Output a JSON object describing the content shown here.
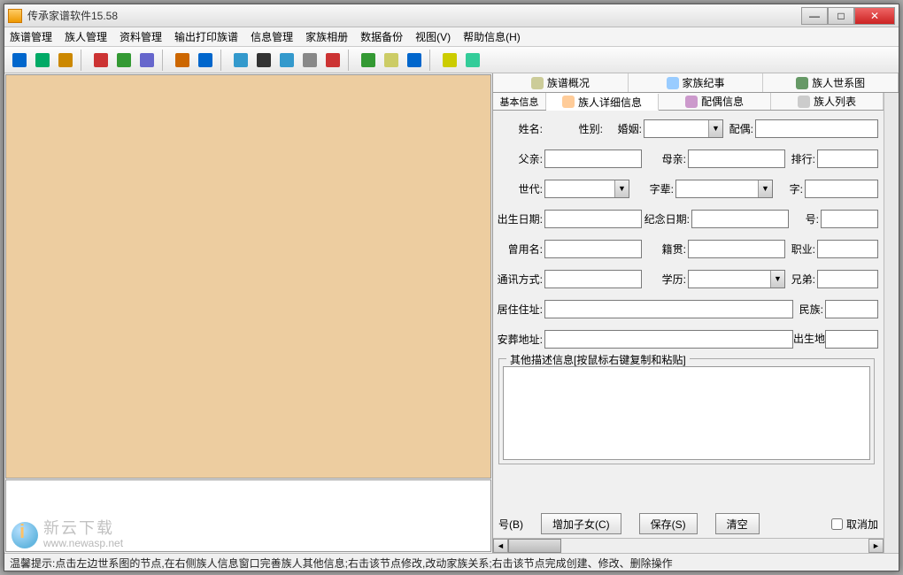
{
  "window": {
    "title": "传承家谱软件15.58"
  },
  "menu": [
    "族谱管理",
    "族人管理",
    "资料管理",
    "输出打印族谱",
    "信息管理",
    "家族相册",
    "数据备份",
    "视图(V)",
    "帮助信息(H)"
  ],
  "toolbar_icons": [
    {
      "name": "book-icon",
      "c": "#06c"
    },
    {
      "name": "globe-icon",
      "c": "#0a6"
    },
    {
      "name": "export-icon",
      "c": "#c80"
    },
    {
      "sep": true
    },
    {
      "name": "user-add-icon",
      "c": "#c33"
    },
    {
      "name": "user-del-icon",
      "c": "#393"
    },
    {
      "name": "user-edit-icon",
      "c": "#66c"
    },
    {
      "sep": true
    },
    {
      "name": "group-icon",
      "c": "#c60"
    },
    {
      "name": "people-icon",
      "c": "#06c"
    },
    {
      "sep": true
    },
    {
      "name": "copy-icon",
      "c": "#39c"
    },
    {
      "name": "find-icon",
      "c": "#333"
    },
    {
      "name": "layers-icon",
      "c": "#39c"
    },
    {
      "name": "gear-icon",
      "c": "#888"
    },
    {
      "name": "chart-icon",
      "c": "#c33"
    },
    {
      "sep": true
    },
    {
      "name": "tag-icon",
      "c": "#393"
    },
    {
      "name": "folder-icon",
      "c": "#cc6"
    },
    {
      "name": "font-a-icon",
      "c": "#06c"
    },
    {
      "sep": true
    },
    {
      "name": "chat-icon",
      "c": "#cc0"
    },
    {
      "name": "window-icon",
      "c": "#3c9"
    }
  ],
  "tabs_top": [
    {
      "icon": "book-icon",
      "label": "族谱概况"
    },
    {
      "icon": "diamond-icon",
      "label": "家族纪事"
    },
    {
      "icon": "tree-icon",
      "label": "族人世系图"
    }
  ],
  "tabs_sub": [
    {
      "icon": "user-icon",
      "label": "族人详细信息",
      "active": true
    },
    {
      "icon": "ring-icon",
      "label": "配偶信息"
    },
    {
      "icon": "list-icon",
      "label": "族人列表"
    }
  ],
  "tabs_sub_prefix": "基本信息",
  "form": {
    "r1": {
      "l1": "姓名:",
      "l2": "性别:",
      "l3": "婚姻:",
      "l4": "配偶:"
    },
    "r2": {
      "l1": "父亲:",
      "l2": "母亲:",
      "l3": "排行:"
    },
    "r3": {
      "l1": "世代:",
      "l2": "字辈:",
      "l3": "字:"
    },
    "r4": {
      "l1": "出生日期:",
      "l2": "纪念日期:",
      "l3": "号:"
    },
    "r5": {
      "l1": "曾用名:",
      "l2": "籍贯:",
      "l3": "职业:"
    },
    "r6": {
      "l1": "通讯方式:",
      "l2": "学历:",
      "l3": "兄弟:"
    },
    "r7": {
      "l1": "居住住址:",
      "l2": "民族:"
    },
    "r8": {
      "l1": "安葬地址:",
      "l2": "出生地址:"
    }
  },
  "group_label": "其他描述信息[按鼠标右键复制和粘贴]",
  "buttons": {
    "b1": "号(B)",
    "b2": "增加子女(C)",
    "b3": "保存(S)",
    "b4": "清空",
    "chk": "取消加"
  },
  "status": "温馨提示:点击左边世系图的节点,在右侧族人信息窗口完善族人其他信息;右击该节点修改,改动家族关系;右击该节点完成创建、修改、删除操作",
  "watermark": {
    "line1": "新云下载",
    "line2": "www.newasp.net"
  }
}
